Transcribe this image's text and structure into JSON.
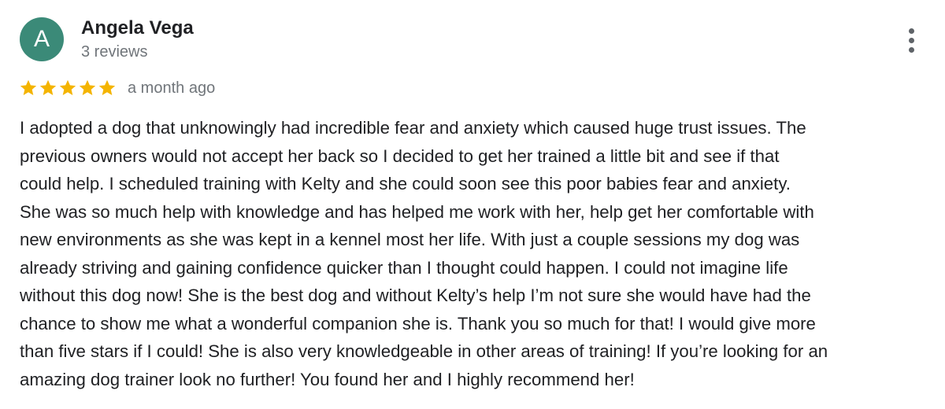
{
  "reviewer": {
    "initial": "A",
    "name": "Angela Vega",
    "review_count": "3 reviews",
    "avatar_color": "#3b8a78"
  },
  "rating": {
    "stars": 5,
    "max_stars": 5,
    "star_color": "#f4b400",
    "date": "a month ago"
  },
  "menu": {
    "icon": "more-vert-icon"
  },
  "review": {
    "lines": [
      "I adopted a dog that unknowingly had incredible fear and anxiety which caused huge trust issues. The",
      "previous owners would not accept her back so I decided to get her trained a little bit and see if that",
      "could help. I scheduled training with Kelty and she could soon see this poor babies fear and anxiety.",
      "She was so much help with knowledge and has helped me work with her, help get her comfortable with",
      "new environments as she was kept in a kennel most her life. With just a couple sessions my dog was",
      "already striving and gaining confidence quicker than I thought could happen. I could not imagine life",
      "without this dog now! She is the best dog and without Kelty’s help I’m not sure she would have had the",
      "chance to show me what a wonderful companion she is. Thank you so much for that! I would give more",
      "than five stars if I could! She is also very knowledgeable in other areas of training! If you’re looking for an",
      "amazing dog trainer look no further! You found her and I highly recommend her!"
    ]
  }
}
